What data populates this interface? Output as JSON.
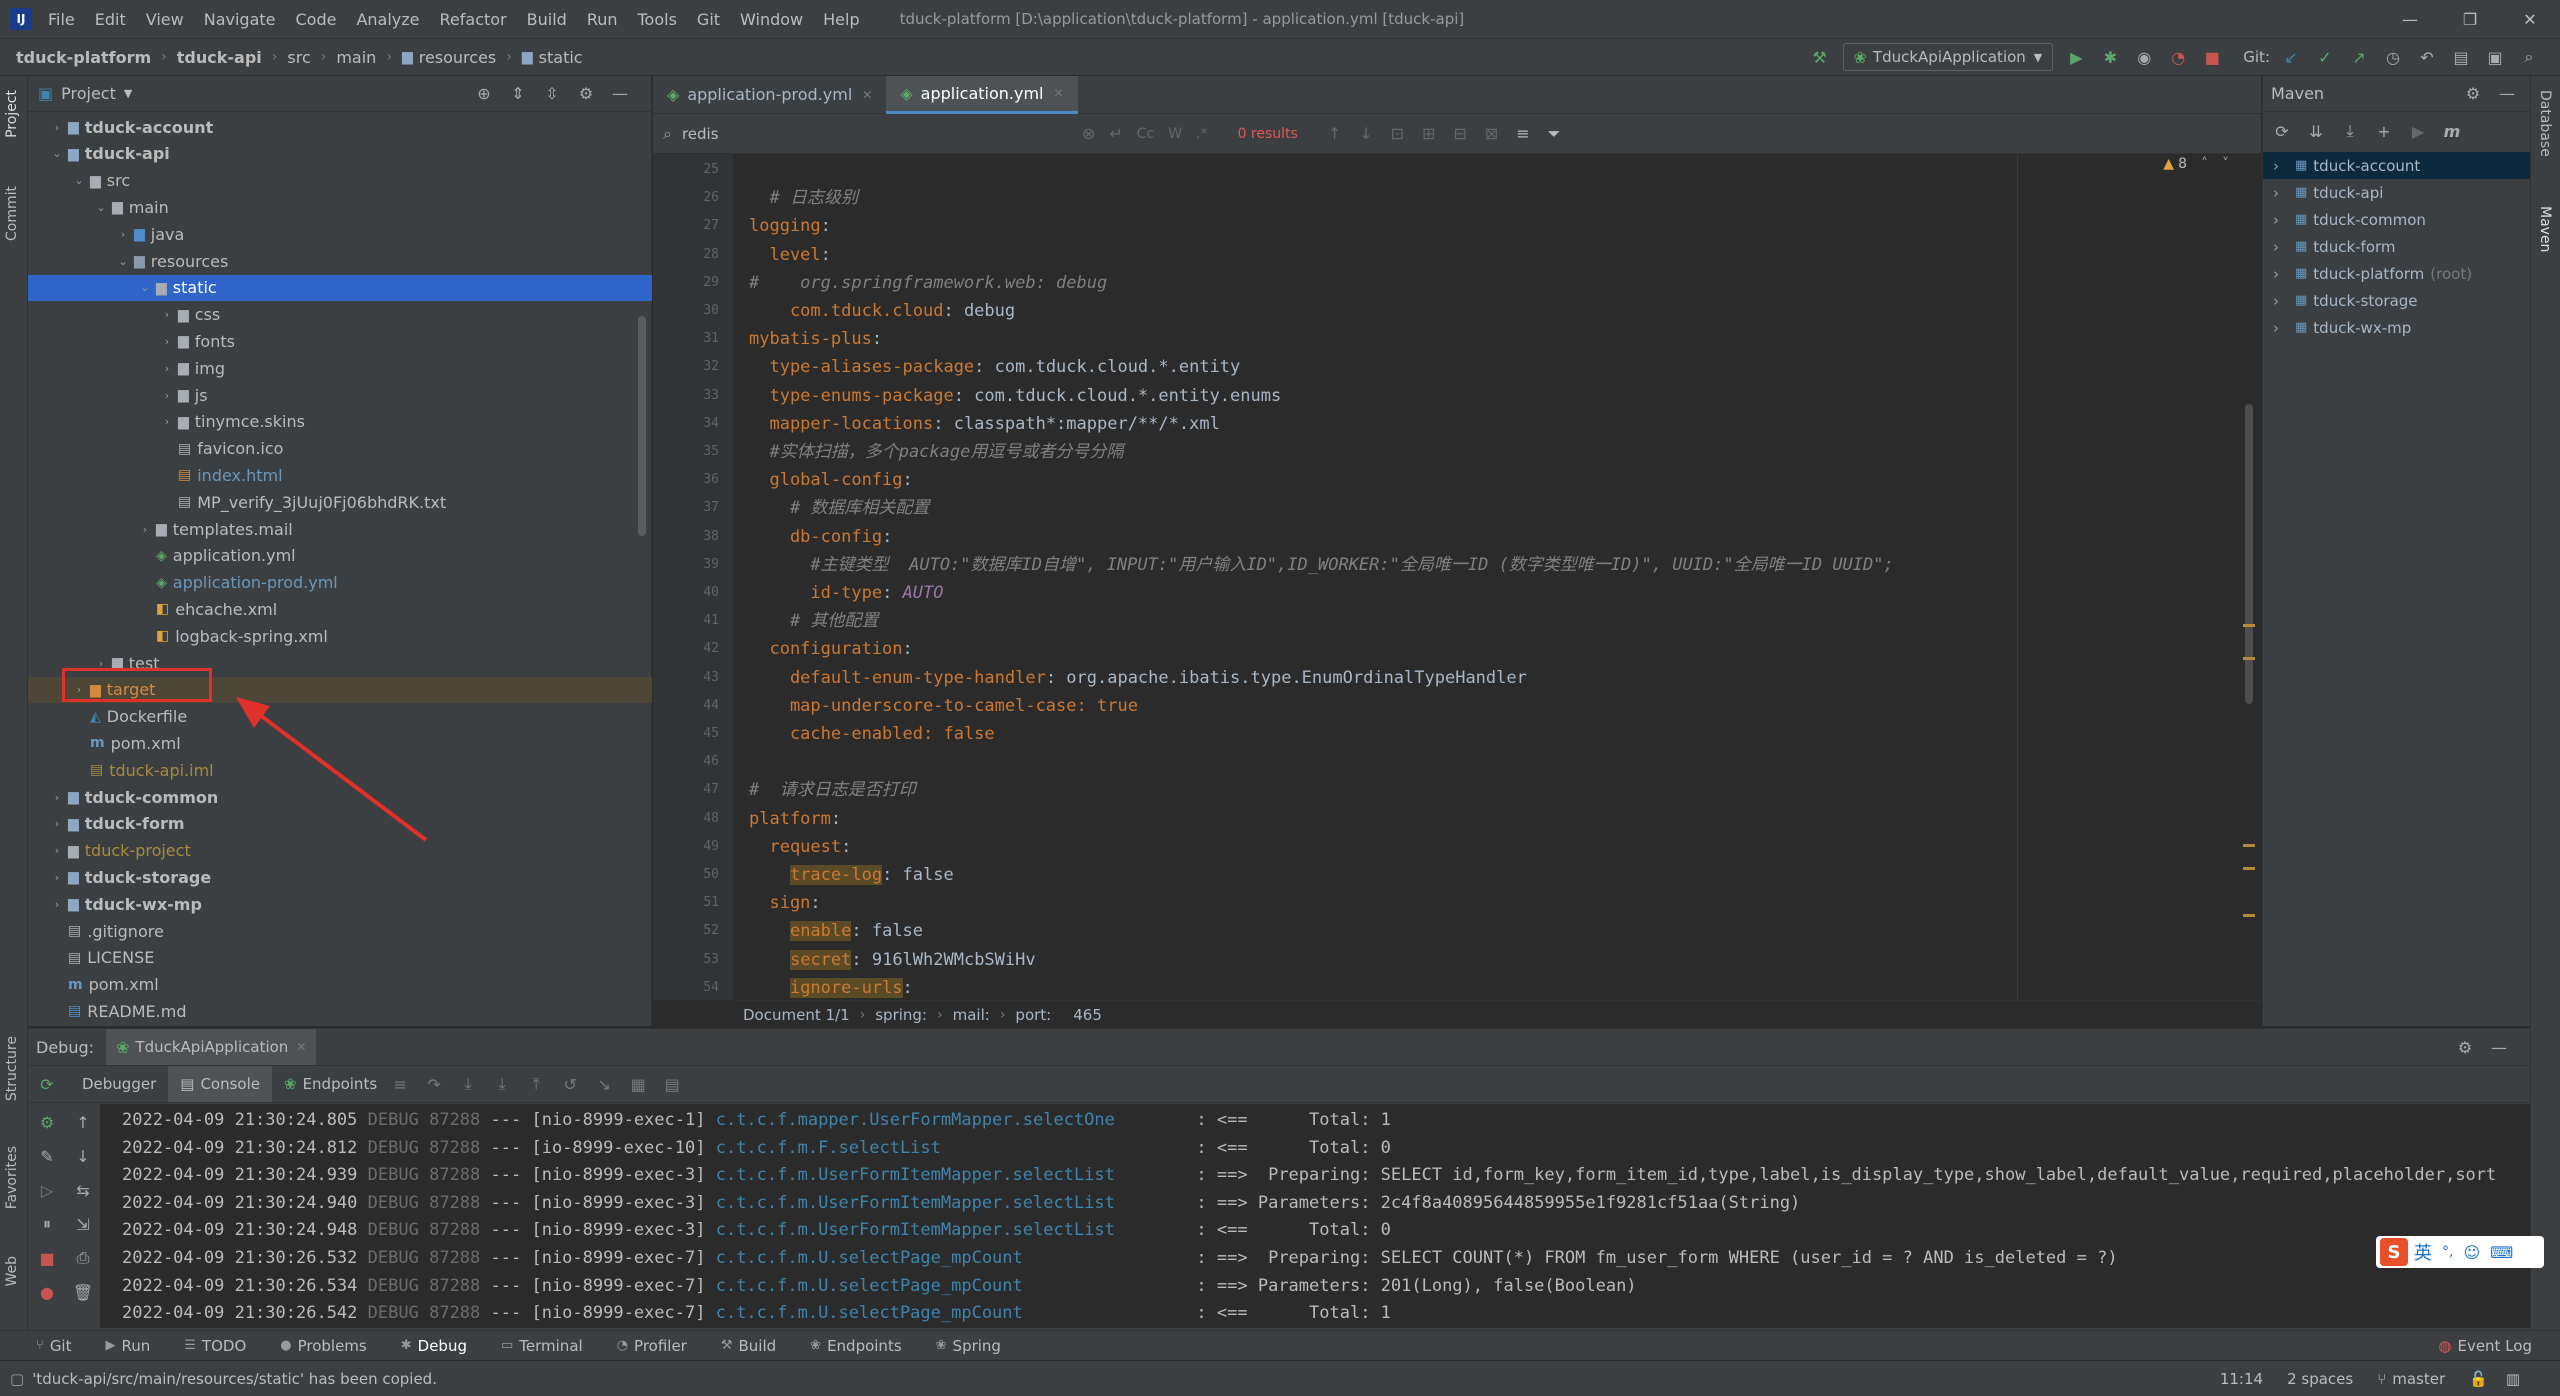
{
  "colors": {
    "background": "#2b2b2b",
    "panel": "#3c3f41",
    "selection": "#2f65ca",
    "accent_red": "#e0302a",
    "keyword": "#cc7832",
    "comment": "#808080",
    "logger": "#3d84ad",
    "run_green": "#59a869",
    "stop_red": "#c75450"
  },
  "menubar": {
    "items": [
      "File",
      "Edit",
      "View",
      "Navigate",
      "Code",
      "Analyze",
      "Refactor",
      "Build",
      "Run",
      "Tools",
      "Git",
      "Window",
      "Help"
    ],
    "window_title": "tduck-platform [D:\\application\\tduck-platform] - application.yml [tduck-api]"
  },
  "navbar": {
    "breadcrumbs": [
      "tduck-platform",
      "tduck-api",
      "src",
      "main",
      "resources",
      "static"
    ],
    "run_config": "TduckApiApplication",
    "git_label": "Git:"
  },
  "left_strip": {
    "project_tab": "Project",
    "commit_tab": "Commit",
    "structure_tab": "Structure",
    "favorites_tab": "Favorites",
    "web_tab": "Web"
  },
  "project": {
    "header": "Project",
    "tree": [
      {
        "label": "tduck-account",
        "depth": 1,
        "icon": "module",
        "arrow": "collapsed",
        "bold": true
      },
      {
        "label": "tduck-api",
        "depth": 1,
        "icon": "module",
        "arrow": "expanded",
        "bold": true
      },
      {
        "label": "src",
        "depth": 2,
        "icon": "folder",
        "arrow": "expanded"
      },
      {
        "label": "main",
        "depth": 3,
        "icon": "folder",
        "arrow": "expanded"
      },
      {
        "label": "java",
        "depth": 4,
        "icon": "folder-src",
        "arrow": "collapsed"
      },
      {
        "label": "resources",
        "depth": 4,
        "icon": "folder-res",
        "arrow": "expanded"
      },
      {
        "label": "static",
        "depth": 5,
        "icon": "folder",
        "arrow": "expanded",
        "selected": true
      },
      {
        "label": "css",
        "depth": 6,
        "icon": "folder",
        "arrow": "collapsed"
      },
      {
        "label": "fonts",
        "depth": 6,
        "icon": "folder",
        "arrow": "collapsed"
      },
      {
        "label": "img",
        "depth": 6,
        "icon": "folder",
        "arrow": "collapsed"
      },
      {
        "label": "js",
        "depth": 6,
        "icon": "folder",
        "arrow": "collapsed"
      },
      {
        "label": "tinymce.skins",
        "depth": 6,
        "icon": "folder",
        "arrow": "collapsed"
      },
      {
        "label": "favicon.ico",
        "depth": 6,
        "icon": "file",
        "arrow": "none"
      },
      {
        "label": "index.html",
        "depth": 6,
        "icon": "html",
        "arrow": "none",
        "color": "#6897bb"
      },
      {
        "label": "MP_verify_3jUuj0Fj06bhdRK.txt",
        "depth": 6,
        "icon": "file",
        "arrow": "none"
      },
      {
        "label": "templates.mail",
        "depth": 5,
        "icon": "folder",
        "arrow": "collapsed"
      },
      {
        "label": "application.yml",
        "depth": 5,
        "icon": "yml",
        "arrow": "none"
      },
      {
        "label": "application-prod.yml",
        "depth": 5,
        "icon": "yml",
        "arrow": "none",
        "color": "#6897bb"
      },
      {
        "label": "ehcache.xml",
        "depth": 5,
        "icon": "xml",
        "arrow": "none"
      },
      {
        "label": "logback-spring.xml",
        "depth": 5,
        "icon": "xml",
        "arrow": "none"
      },
      {
        "label": "test",
        "depth": 3,
        "icon": "folder",
        "arrow": "collapsed"
      },
      {
        "label": "target",
        "depth": 2,
        "icon": "folder-excluded",
        "arrow": "collapsed",
        "excluded": true,
        "color": "#d48a3e"
      },
      {
        "label": "Dockerfile",
        "depth": 2,
        "icon": "docker",
        "arrow": "none"
      },
      {
        "label": "pom.xml",
        "depth": 2,
        "icon": "maven",
        "arrow": "none"
      },
      {
        "label": "tduck-api.iml",
        "depth": 2,
        "icon": "iml",
        "arrow": "none",
        "color": "#a68a3a"
      },
      {
        "label": "tduck-common",
        "depth": 1,
        "icon": "module",
        "arrow": "collapsed",
        "bold": true
      },
      {
        "label": "tduck-form",
        "depth": 1,
        "icon": "module",
        "arrow": "collapsed",
        "bold": true
      },
      {
        "label": "tduck-project",
        "depth": 1,
        "icon": "folder",
        "arrow": "collapsed",
        "color": "#a68a3a"
      },
      {
        "label": "tduck-storage",
        "depth": 1,
        "icon": "module",
        "arrow": "collapsed",
        "bold": true
      },
      {
        "label": "tduck-wx-mp",
        "depth": 1,
        "icon": "module",
        "arrow": "collapsed",
        "bold": true
      },
      {
        "label": ".gitignore",
        "depth": 1,
        "icon": "file",
        "arrow": "none"
      },
      {
        "label": "LICENSE",
        "depth": 1,
        "icon": "file",
        "arrow": "none"
      },
      {
        "label": "pom.xml",
        "depth": 1,
        "icon": "maven",
        "arrow": "none"
      },
      {
        "label": "README.md",
        "depth": 1,
        "icon": "md",
        "arrow": "none"
      }
    ]
  },
  "editor": {
    "tabs": [
      {
        "label": "application-prod.yml",
        "active": false
      },
      {
        "label": "application.yml",
        "active": true
      }
    ],
    "search": {
      "query": "redis",
      "results": "0 results",
      "match_case": "Cc",
      "words": "W"
    },
    "warning_count": "8",
    "first_line_number": 25,
    "lines": [
      [],
      [
        {
          "t": "  ",
          "c": "v"
        },
        {
          "t": "# 日志级别",
          "c": "c"
        }
      ],
      [
        {
          "t": "logging",
          "c": "k"
        },
        {
          "t": ":",
          "c": "v"
        }
      ],
      [
        {
          "t": "  level",
          "c": "k"
        },
        {
          "t": ":",
          "c": "v"
        }
      ],
      [
        {
          "t": "#    org.springframework.web: debug",
          "c": "c"
        }
      ],
      [
        {
          "t": "    com.tduck.cloud",
          "c": "k"
        },
        {
          "t": ": debug",
          "c": "v"
        }
      ],
      [
        {
          "t": "mybatis-plus",
          "c": "k"
        },
        {
          "t": ":",
          "c": "v"
        }
      ],
      [
        {
          "t": "  type-aliases-package",
          "c": "k"
        },
        {
          "t": ": com.tduck.cloud.*.entity",
          "c": "v"
        }
      ],
      [
        {
          "t": "  type-enums-package",
          "c": "k"
        },
        {
          "t": ": com.tduck.cloud.*.entity.enums",
          "c": "v"
        }
      ],
      [
        {
          "t": "  mapper-locations",
          "c": "k"
        },
        {
          "t": ": classpath*:mapper/**/*.xml",
          "c": "v"
        }
      ],
      [
        {
          "t": "  #实体扫描，多个package用逗号或者分号分隔",
          "c": "c"
        }
      ],
      [
        {
          "t": "  global-config",
          "c": "k"
        },
        {
          "t": ":",
          "c": "v"
        }
      ],
      [
        {
          "t": "    # 数据库相关配置",
          "c": "c"
        }
      ],
      [
        {
          "t": "    db-config",
          "c": "k"
        },
        {
          "t": ":",
          "c": "v"
        }
      ],
      [
        {
          "t": "      #主键类型  AUTO:\"数据库ID自增\", INPUT:\"用户输入ID\",ID_WORKER:\"全局唯一ID (数字类型唯一ID)\", UUID:\"全局唯一ID UUID\";",
          "c": "c"
        }
      ],
      [
        {
          "t": "      id-type",
          "c": "k"
        },
        {
          "t": ": ",
          "c": "v"
        },
        {
          "t": "AUTO",
          "c": "ita"
        }
      ],
      [
        {
          "t": "    # 其他配置",
          "c": "c"
        }
      ],
      [
        {
          "t": "  configuration",
          "c": "k"
        },
        {
          "t": ":",
          "c": "v"
        }
      ],
      [
        {
          "t": "    default-enum-type-handler",
          "c": "k"
        },
        {
          "t": ": org.apache.ibatis.type.EnumOrdinalTypeHandler",
          "c": "v"
        }
      ],
      [
        {
          "t": "    map-underscore-to-camel-case",
          "c": "k"
        },
        {
          "t": ": true",
          "c": "k"
        }
      ],
      [
        {
          "t": "    cache-enabled",
          "c": "k"
        },
        {
          "t": ": false",
          "c": "k"
        }
      ],
      [],
      [
        {
          "t": "#  请求日志是否打印",
          "c": "c"
        }
      ],
      [
        {
          "t": "platform",
          "c": "k"
        },
        {
          "t": ":",
          "c": "v"
        }
      ],
      [
        {
          "t": "  request",
          "c": "k"
        },
        {
          "t": ":",
          "c": "v"
        }
      ],
      [
        {
          "t": "    ",
          "c": "v"
        },
        {
          "t": "trace-log",
          "c": "hl"
        },
        {
          "t": ": false",
          "c": "v"
        }
      ],
      [
        {
          "t": "  sign",
          "c": "k"
        },
        {
          "t": ":",
          "c": "v"
        }
      ],
      [
        {
          "t": "    ",
          "c": "v"
        },
        {
          "t": "enable",
          "c": "hl"
        },
        {
          "t": ": false",
          "c": "v"
        }
      ],
      [
        {
          "t": "    ",
          "c": "v"
        },
        {
          "t": "secret",
          "c": "hl"
        },
        {
          "t": ": 916lWh2WMcbSWiHv",
          "c": "v"
        }
      ],
      [
        {
          "t": "    ",
          "c": "v"
        },
        {
          "t": "ignore-urls",
          "c": "hl"
        },
        {
          "t": ":",
          "c": "v"
        }
      ]
    ],
    "breadcrumbs": [
      "Document 1/1",
      "spring:",
      "mail:",
      "port:",
      "465"
    ]
  },
  "maven": {
    "title": "Maven",
    "projects": [
      {
        "label": "tduck-account",
        "selected": true
      },
      {
        "label": "tduck-api"
      },
      {
        "label": "tduck-common"
      },
      {
        "label": "tduck-form"
      },
      {
        "label": "tduck-platform",
        "suffix": "(root)"
      },
      {
        "label": "tduck-storage"
      },
      {
        "label": "tduck-wx-mp"
      }
    ]
  },
  "right_strip": {
    "database_tab": "Database",
    "maven_tab": "Maven"
  },
  "debug": {
    "label": "Debug:",
    "session": "TduckApiApplication",
    "tabs": [
      "Debugger",
      "Console",
      "Endpoints"
    ],
    "log": [
      {
        "ts": "2022-04-09 21:30:24.805",
        "level": "DEBUG",
        "pid": "87288",
        "thread": "[nio-8999-exec-1]",
        "logger": "c.t.c.f.mapper.UserFormMapper.selectOne",
        "msg": "<==      Total: 1"
      },
      {
        "ts": "2022-04-09 21:30:24.812",
        "level": "DEBUG",
        "pid": "87288",
        "thread": "[io-8999-exec-10]",
        "logger": "c.t.c.f.m.F.selectList",
        "msg": "<==      Total: 0"
      },
      {
        "ts": "2022-04-09 21:30:24.939",
        "level": "DEBUG",
        "pid": "87288",
        "thread": "[nio-8999-exec-3]",
        "logger": "c.t.c.f.m.UserFormItemMapper.selectList",
        "msg": "==>  Preparing: SELECT id,form_key,form_item_id,type,label,is_display_type,show_label,default_value,required,placeholder,sort"
      },
      {
        "ts": "2022-04-09 21:30:24.940",
        "level": "DEBUG",
        "pid": "87288",
        "thread": "[nio-8999-exec-3]",
        "logger": "c.t.c.f.m.UserFormItemMapper.selectList",
        "msg": "==> Parameters: 2c4f8a40895644859955e1f9281cf51aa(String)"
      },
      {
        "ts": "2022-04-09 21:30:24.948",
        "level": "DEBUG",
        "pid": "87288",
        "thread": "[nio-8999-exec-3]",
        "logger": "c.t.c.f.m.UserFormItemMapper.selectList",
        "msg": "<==      Total: 0"
      },
      {
        "ts": "2022-04-09 21:30:26.532",
        "level": "DEBUG",
        "pid": "87288",
        "thread": "[nio-8999-exec-7]",
        "logger": "c.t.c.f.m.U.selectPage_mpCount",
        "msg": "==>  Preparing: SELECT COUNT(*) FROM fm_user_form WHERE (user_id = ? AND is_deleted = ?)"
      },
      {
        "ts": "2022-04-09 21:30:26.534",
        "level": "DEBUG",
        "pid": "87288",
        "thread": "[nio-8999-exec-7]",
        "logger": "c.t.c.f.m.U.selectPage_mpCount",
        "msg": "==> Parameters: 201(Long), false(Boolean)"
      },
      {
        "ts": "2022-04-09 21:30:26.542",
        "level": "DEBUG",
        "pid": "87288",
        "thread": "[nio-8999-exec-7]",
        "logger": "c.t.c.f.m.U.selectPage_mpCount",
        "msg": "<==      Total: 1"
      }
    ]
  },
  "ime": {
    "label": "英"
  },
  "toolwindows": {
    "items": [
      "Git",
      "Run",
      "TODO",
      "Problems",
      "Debug",
      "Terminal",
      "Profiler",
      "Build",
      "Endpoints",
      "Spring"
    ],
    "active": "Debug",
    "event_log": "Event Log"
  },
  "status": {
    "message": "'tduck-api/src/main/resources/static' has been copied.",
    "position": "11:14",
    "indent": "2 spaces",
    "branch": "master"
  }
}
